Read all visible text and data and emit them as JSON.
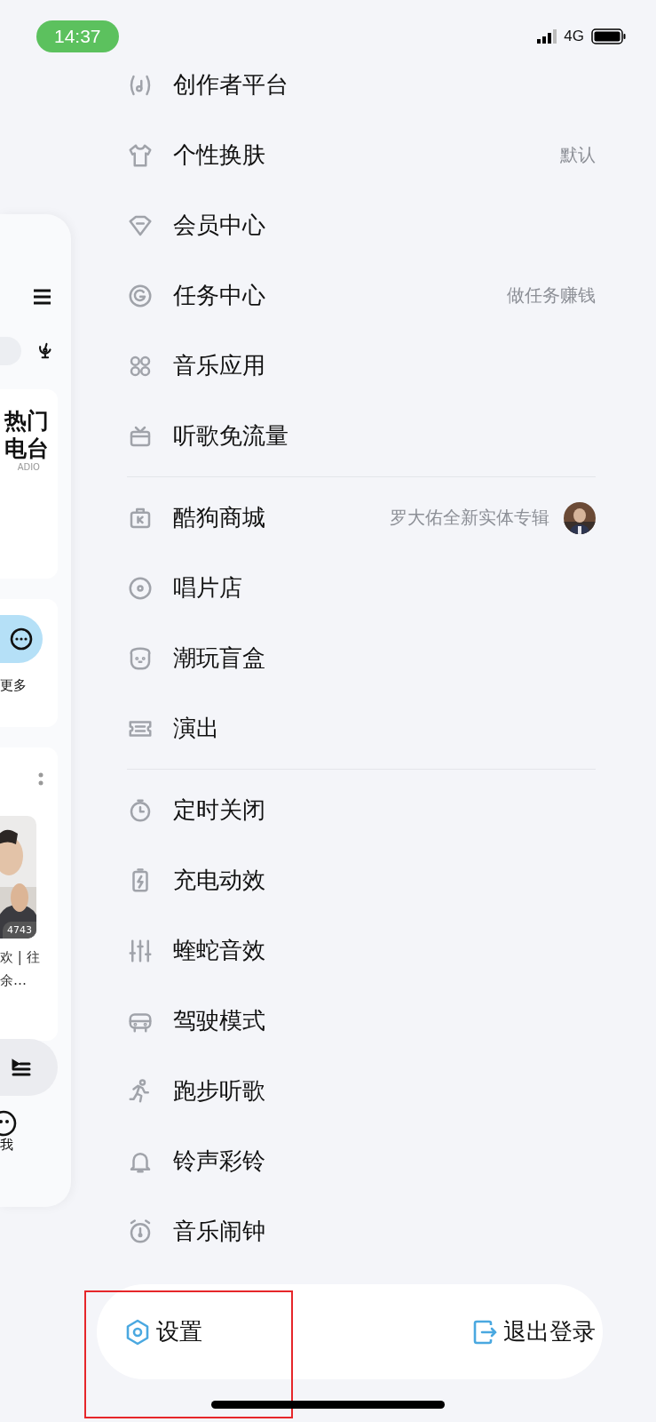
{
  "status_bar": {
    "time": "14:37",
    "network": "4G"
  },
  "background_panel": {
    "card_title": [
      "热门",
      "电台"
    ],
    "card_subtitle": "ADIO",
    "more_label": "更多",
    "play_count": "4743",
    "song_lines": [
      "欢 | 往",
      "余…"
    ],
    "me_label": "我"
  },
  "menu": {
    "sections": [
      {
        "items": [
          {
            "kind": "creator",
            "label": "创作者平台"
          },
          {
            "kind": "shirt",
            "label": "个性换肤",
            "value": "默认"
          },
          {
            "kind": "diamond",
            "label": "会员中心"
          },
          {
            "kind": "coin",
            "label": "任务中心",
            "value": "做任务赚钱"
          },
          {
            "kind": "apps",
            "label": "音乐应用"
          },
          {
            "kind": "gift",
            "label": "听歌免流量"
          }
        ]
      },
      {
        "items": [
          {
            "kind": "bag",
            "label": "酷狗商城",
            "value": "罗大佑全新实体专辑"
          },
          {
            "kind": "disc",
            "label": "唱片店"
          },
          {
            "kind": "bear",
            "label": "潮玩盲盒"
          },
          {
            "kind": "ticket",
            "label": "演出"
          }
        ]
      },
      {
        "items": [
          {
            "kind": "timer",
            "label": "定时关闭"
          },
          {
            "kind": "charge",
            "label": "充电动效"
          },
          {
            "kind": "equalizer",
            "label": "蝰蛇音效"
          },
          {
            "kind": "car",
            "label": "驾驶模式"
          },
          {
            "kind": "runner",
            "label": "跑步听歌"
          },
          {
            "kind": "bell",
            "label": "铃声彩铃"
          },
          {
            "kind": "alarm",
            "label": "音乐闹钟"
          }
        ]
      }
    ]
  },
  "bottom_bar": {
    "settings": "设置",
    "logout": "退出登录"
  },
  "highlight": {
    "shown": true
  }
}
